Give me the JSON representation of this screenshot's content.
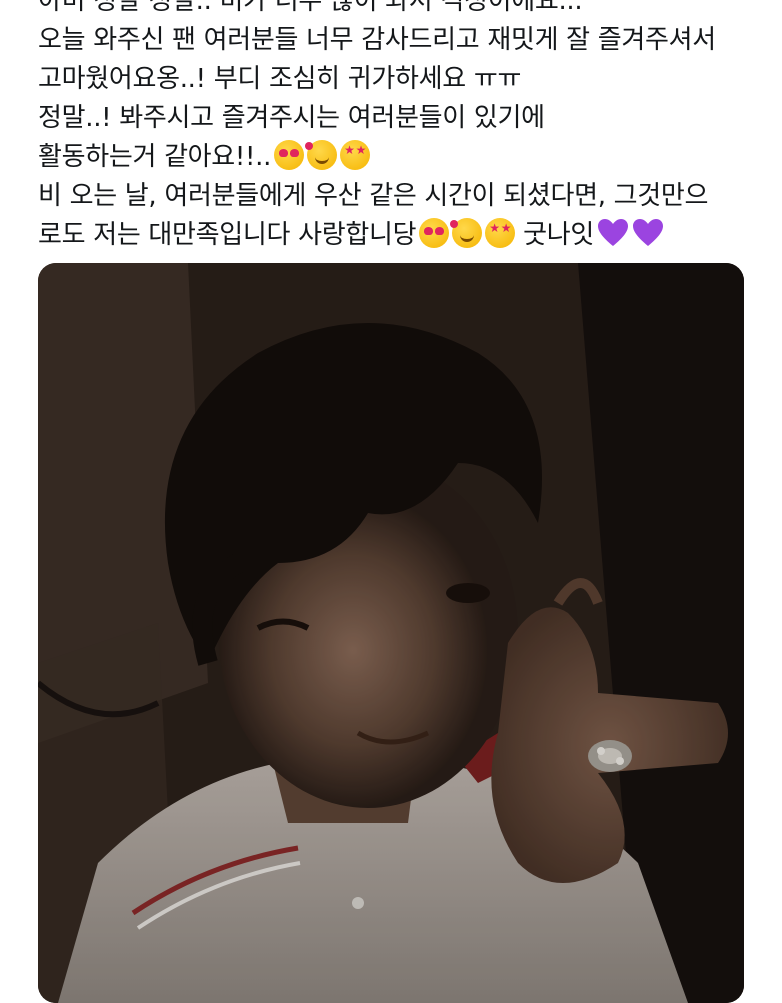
{
  "tweet": {
    "lines": [
      "아미 정말 정말.. 비가 너무 많이 와서 걱정이에요...",
      "오늘 와주신 팬 여러분들 너무 감사드리고 재밋게 잘 즐겨주셔서",
      "고마웠어요옹..! 부디 조심히 귀가하세요 ㅠㅠ",
      "정말..! 봐주시고 즐겨주시는 여러분들이 있기에",
      "활동하는거 같아요!!..",
      "비 오는 날, 여러분들에게 우산 같은 시간이 되셨다면, 그것만으",
      "로도 저는 대만족입니다  사랑합니당",
      "굿나잇"
    ],
    "emoji_icons": [
      "heart-eyes-face",
      "smiling-face-with-hearts",
      "star-struck-face",
      "purple-heart"
    ]
  },
  "media": {
    "photo_description_icon": "selfie-photo"
  },
  "colors": {
    "text": "#14171a",
    "purple_heart": "#9b44e0",
    "background": "#ffffff"
  }
}
